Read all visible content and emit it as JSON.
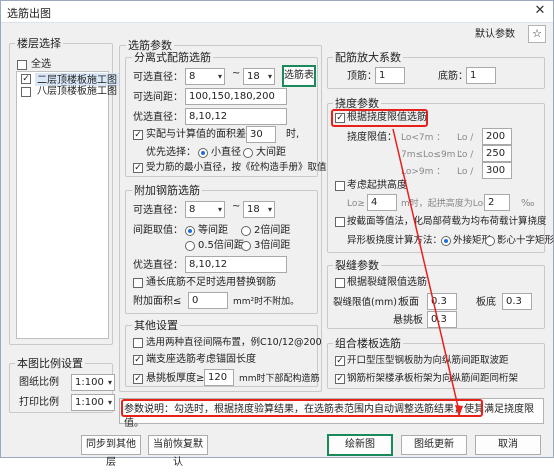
{
  "window": {
    "title": "选筋出图",
    "close_glyph": "✕"
  },
  "top": {
    "default_params_label": "默认参数",
    "star_glyph": "☆"
  },
  "floor_select": {
    "legend": "楼层选择",
    "select_all": "全选",
    "items": [
      {
        "label": "二层顶楼板施工图",
        "checked": true,
        "selected": true
      },
      {
        "label": "八层顶楼板施工图",
        "checked": false,
        "selected": false
      }
    ]
  },
  "scale": {
    "legend": "本图比例设置",
    "drawing_label": "图纸比例",
    "drawing_value": "1:100",
    "print_label": "打印比例",
    "print_value": "1:100"
  },
  "rebar": {
    "legend": "选筋参数",
    "distributed": {
      "legend": "分离式配筋选筋",
      "diameter_label": "可选直径：",
      "dia_from": "8",
      "tilde": "~",
      "dia_to": "18",
      "bar_table_button": "选筋表",
      "spacing_label": "可选间距：",
      "spacing_value": "100,150,180,200",
      "pref_diameter_label": "优选直径：",
      "pref_diameter_value": "8,10,12",
      "area_ratio_label": "实配与计算值的面积差≤",
      "area_ratio_value": "30",
      "area_ratio_unit": "时,",
      "priority_label": "优先选择：",
      "priority_options": [
        "小直径",
        "大间距"
      ],
      "min_dia_label": "受力筋的最小直径，按《砼构造手册》取值"
    },
    "additional": {
      "legend": "附加钢筋选筋",
      "diameter_label": "可选直径：",
      "dia_from": "8",
      "tilde": "~",
      "dia_to": "18",
      "spacing_mode_label": "间距取值：",
      "spacing_options": [
        "等间距",
        "2倍间距",
        "0.5倍间距",
        "3倍间距"
      ],
      "pref_diameter_label": "优选直径：",
      "pref_diameter_value": "8,10,12",
      "long_bar_label": "通长底筋不足时选用替换钢筋",
      "add_area_label": "附加面积≤",
      "add_area_value": "0",
      "add_area_unit": "mm²时不附加。"
    },
    "other": {
      "legend": "其他设置",
      "two_dia_label": "选用两种直径间隔布置，例C10/12@200",
      "full_len_label": "端支座选筋考虑锚固长度",
      "max_thick_label": "悬挑板厚度≥",
      "max_thick_value": "120",
      "max_thick_unit": "mm时下部配构造筋"
    }
  },
  "amplify": {
    "legend": "配筋放大系数",
    "top_label": "顶筋：",
    "top_value": "1",
    "bottom_label": "底筋：",
    "bottom_value": "1"
  },
  "deflection": {
    "legend": "挠度参数",
    "limit_check_label": "根据挠度限值选筋",
    "limit_label": "挠度限值：",
    "rows": [
      {
        "cond": "Lo<7m ：",
        "lo": "Lo /",
        "value": "200"
      },
      {
        "cond": "7m≤Lo≤9m ：",
        "lo": "Lo /",
        "value": "250"
      },
      {
        "cond": "Lo>9m ：",
        "lo": "Lo /",
        "value": "300"
      }
    ],
    "arch_label": "考虑起拱高度",
    "lo_ge": "Lo≥",
    "lo_ge_value": "4",
    "arch_mid": "m时，起拱高度为Lo的",
    "arch_value": "2",
    "arch_unit": "‰",
    "uniform_label": "按截面等值法，化局部荷载为均布荷载计算挠度",
    "shape_label": "异形板挠度计算方法：",
    "shape_options": [
      "外接矩形",
      "影心十字矩形"
    ]
  },
  "crack": {
    "legend": "裂缝参数",
    "check_label": "根据裂缝限值选筋",
    "limit_label": "裂缝限值(mm)：",
    "panel_label": "板面",
    "panel_value": "0.3",
    "bottom_label": "板底",
    "bottom_value": "0.3",
    "cant_label": "悬挑板",
    "cant_value": "0.3"
  },
  "combo": {
    "legend": "组合楼板选筋",
    "open_label": "开口型压型钢板肋为向纵筋间距取波距",
    "truss_label": "钢筋桁架楼承板桁架为向纵筋间距同桁架"
  },
  "description": "参数说明：勾选时，根据挠度验算结果，在选筋表范围内自动调整选筋结果，使其满足挠度限值。",
  "buttons": {
    "sync": "同步到其他层",
    "restore": "当前恢复默认",
    "draw": "绘新图",
    "update": "图纸更新",
    "cancel": "取消"
  },
  "colors": {
    "highlight": "#e8201c",
    "accent": "#1e6fd9",
    "primary_border": "#1b8a5a"
  }
}
